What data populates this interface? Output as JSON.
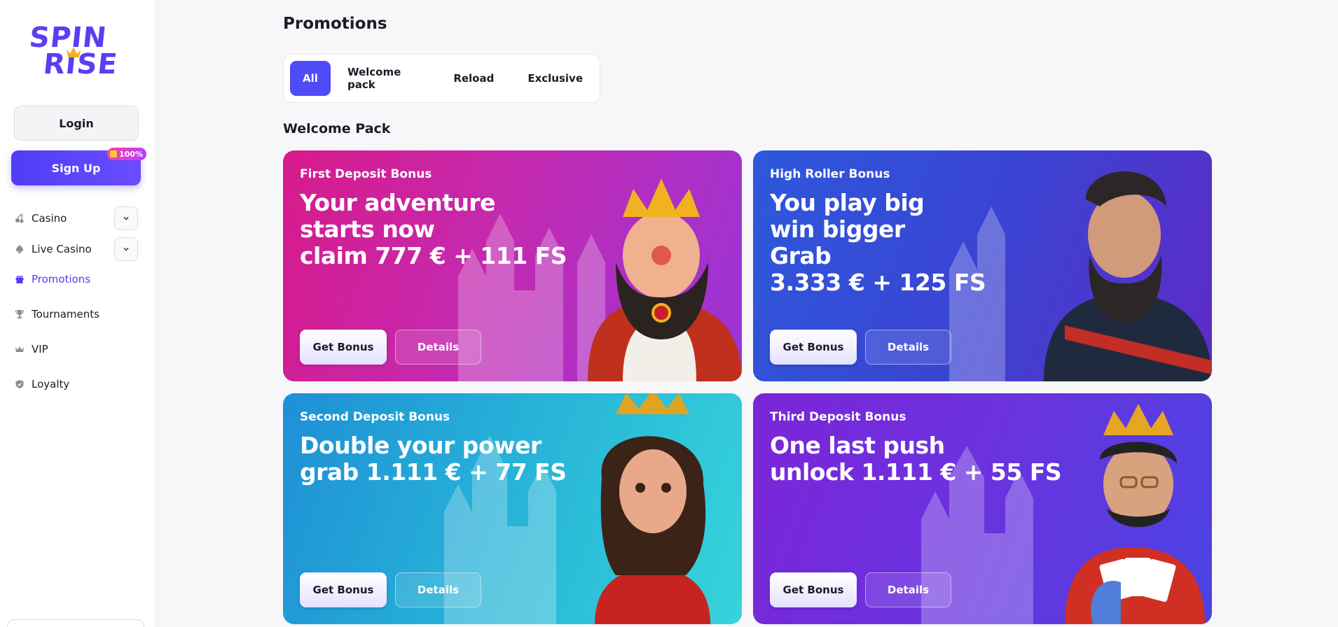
{
  "brand": {
    "logo_line1": "SPIN",
    "logo_line2": "RISE",
    "accent": "#4f4bf6"
  },
  "auth": {
    "login_label": "Login",
    "signup_label": "Sign Up",
    "signup_badge": "100%"
  },
  "sidebar": {
    "items": [
      {
        "label": "Casino",
        "icon": "cherries-icon",
        "expandable": true
      },
      {
        "label": "Live Casino",
        "icon": "spade-icon",
        "expandable": true
      },
      {
        "label": "Promotions",
        "icon": "gift-icon",
        "active": true
      },
      {
        "label": "Tournaments",
        "icon": "trophy-icon"
      },
      {
        "label": "VIP",
        "icon": "crown-icon"
      },
      {
        "label": "Loyalty",
        "icon": "shield-icon"
      }
    ]
  },
  "page": {
    "title": "Promotions",
    "section_title": "Welcome Pack"
  },
  "tabs": [
    {
      "label": "All",
      "active": true
    },
    {
      "label": "Welcome pack"
    },
    {
      "label": "Reload"
    },
    {
      "label": "Exclusive"
    }
  ],
  "cards": [
    {
      "eyebrow": "First Deposit Bonus",
      "headline": "Your adventure\nstarts now\nclaim 777 € + 111 FS",
      "get_label": "Get Bonus",
      "details_label": "Details",
      "colors": [
        "#e0208f",
        "#a02ad6"
      ]
    },
    {
      "eyebrow": "High Roller Bonus",
      "headline": "You play big\nwin bigger\nGrab\n3.333 € + 125 FS",
      "get_label": "Get Bonus",
      "details_label": "Details",
      "colors": [
        "#2f54d8",
        "#5a2cc9"
      ]
    },
    {
      "eyebrow": "Second Deposit Bonus",
      "headline": "Double your power\ngrab 1.111 € + 77 FS",
      "get_label": "Get Bonus",
      "details_label": "Details",
      "colors": [
        "#1e9fd8",
        "#2fd0d8"
      ]
    },
    {
      "eyebrow": "Third Deposit Bonus",
      "headline": "One last push\nunlock 1.111 € + 55 FS",
      "get_label": "Get Bonus",
      "details_label": "Details",
      "colors": [
        "#7a27d9",
        "#4a3ee0"
      ]
    }
  ]
}
